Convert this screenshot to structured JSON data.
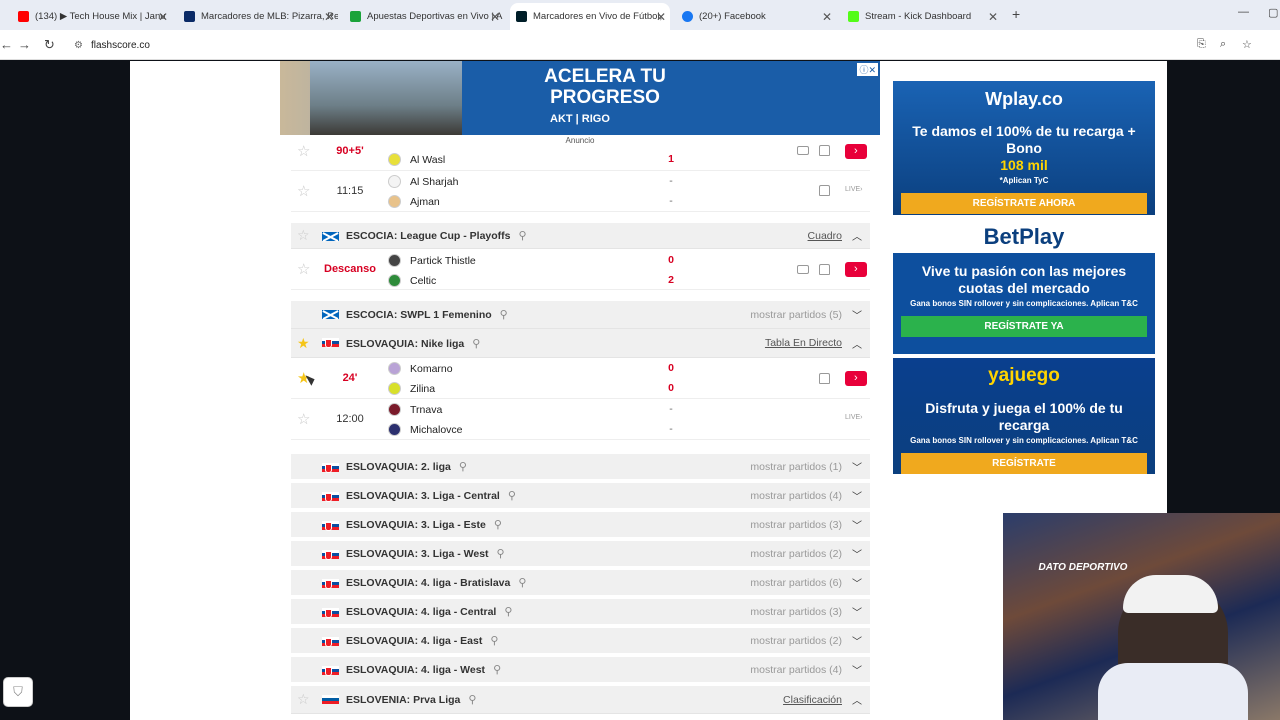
{
  "browser": {
    "tabs": [
      {
        "label": "(134) ▶ Tech House Mix | Janu",
        "fav_color": "#ff0000"
      },
      {
        "label": "Marcadores de MLB: Pizarra, Re",
        "fav_color": "#0a2a66"
      },
      {
        "label": "Apuestas Deportivas en Vivo | A",
        "fav_color": "#1aa33a"
      },
      {
        "label": "Marcadores en Vivo de Fútbol,",
        "fav_color": "#001e28"
      },
      {
        "label": "(20+) Facebook",
        "fav_color": "#1877f2"
      },
      {
        "label": "Stream - Kick Dashboard",
        "fav_color": "#53fc18"
      }
    ],
    "active_tab": 3,
    "url": "flashscore.co"
  },
  "ad_top": {
    "headline": "ACELERA TU PROGRESO",
    "brand": "AKT | RIGO",
    "label": "Anuncio"
  },
  "matches_top": [
    {
      "time": "90+5'",
      "live": true,
      "home": "",
      "away": "Al Wasl",
      "home_score": "",
      "away_score": "1",
      "tv": true,
      "btn": true,
      "partial": true
    },
    {
      "time": "11:15",
      "live": false,
      "home": "Al Sharjah",
      "away": "Ajman",
      "home_score": "-",
      "away_score": "-",
      "live_link": "LIVE›"
    }
  ],
  "league_scotland_cup": {
    "name": "ESCOCIA: League Cup - Playoffs",
    "right": "Cuadro"
  },
  "match_celtic": {
    "time": "Descanso",
    "home": "Partick Thistle",
    "away": "Celtic",
    "home_score": "0",
    "away_score": "2"
  },
  "league_scotland_w": {
    "name": "ESCOCIA: SWPL 1 Femenino",
    "right": "mostrar partidos (5)"
  },
  "league_slovakia": {
    "name": "ESLOVAQUIA: Nike liga",
    "right": "Tabla En Directo"
  },
  "match_komarno": {
    "time": "24'",
    "home": "Komarno",
    "away": "Zilina",
    "home_score": "0",
    "away_score": "0"
  },
  "match_trnava": {
    "time": "12:00",
    "home": "Trnava",
    "away": "Michalovce",
    "home_score": "-",
    "away_score": "-",
    "live_link": "LIVE›"
  },
  "collapsed_leagues": [
    {
      "name": "ESLOVAQUIA: 2. liga",
      "right": "mostrar partidos (1)"
    },
    {
      "name": "ESLOVAQUIA: 3. Liga - Central",
      "right": "mostrar partidos (4)"
    },
    {
      "name": "ESLOVAQUIA: 3. Liga - Este",
      "right": "mostrar partidos (3)"
    },
    {
      "name": "ESLOVAQUIA: 3. Liga - West",
      "right": "mostrar partidos (2)"
    },
    {
      "name": "ESLOVAQUIA: 4. liga - Bratislava",
      "right": "mostrar partidos (6)"
    },
    {
      "name": "ESLOVAQUIA: 4. liga - Central",
      "right": "mostrar partidos (3)"
    },
    {
      "name": "ESLOVAQUIA: 4. liga - East",
      "right": "mostrar partidos (2)"
    },
    {
      "name": "ESLOVAQUIA: 4. liga - West",
      "right": "mostrar partidos (4)"
    }
  ],
  "league_slovenia": {
    "name": "ESLOVENIA: Prva Liga",
    "right": "Clasificación"
  },
  "side_ads": [
    {
      "logo": "Wplay.co",
      "text": "Te damos el 100% de tu recarga + Bono",
      "highlight": "108 mil",
      "small": "*Aplican TyC",
      "cta": "REGÍSTRATE AHORA",
      "cta_color": "#f0a91e"
    },
    {
      "logo": "BetPlay",
      "text": "Vive tu pasión con las mejores cuotas del mercado",
      "highlight": "",
      "small": "Gana bonos SIN rollover y sin complicaciones. Aplican T&C",
      "cta": "REGÍSTRATE YA",
      "cta_color": "#2bb24c"
    },
    {
      "logo": "yajuego",
      "text": "Disfruta y juega el 100% de tu recarga",
      "highlight": "",
      "small": "Gana bonos SIN rollover y sin complicaciones. Aplican T&C",
      "cta": "REGÍSTRATE",
      "cta_color": "#f0a91e"
    }
  ],
  "webcam": {
    "badge": "DATO DEPORTIVO"
  },
  "icons": {
    "star": "star-icon",
    "pin": "pin-icon",
    "chevron": "chevron-icon"
  }
}
